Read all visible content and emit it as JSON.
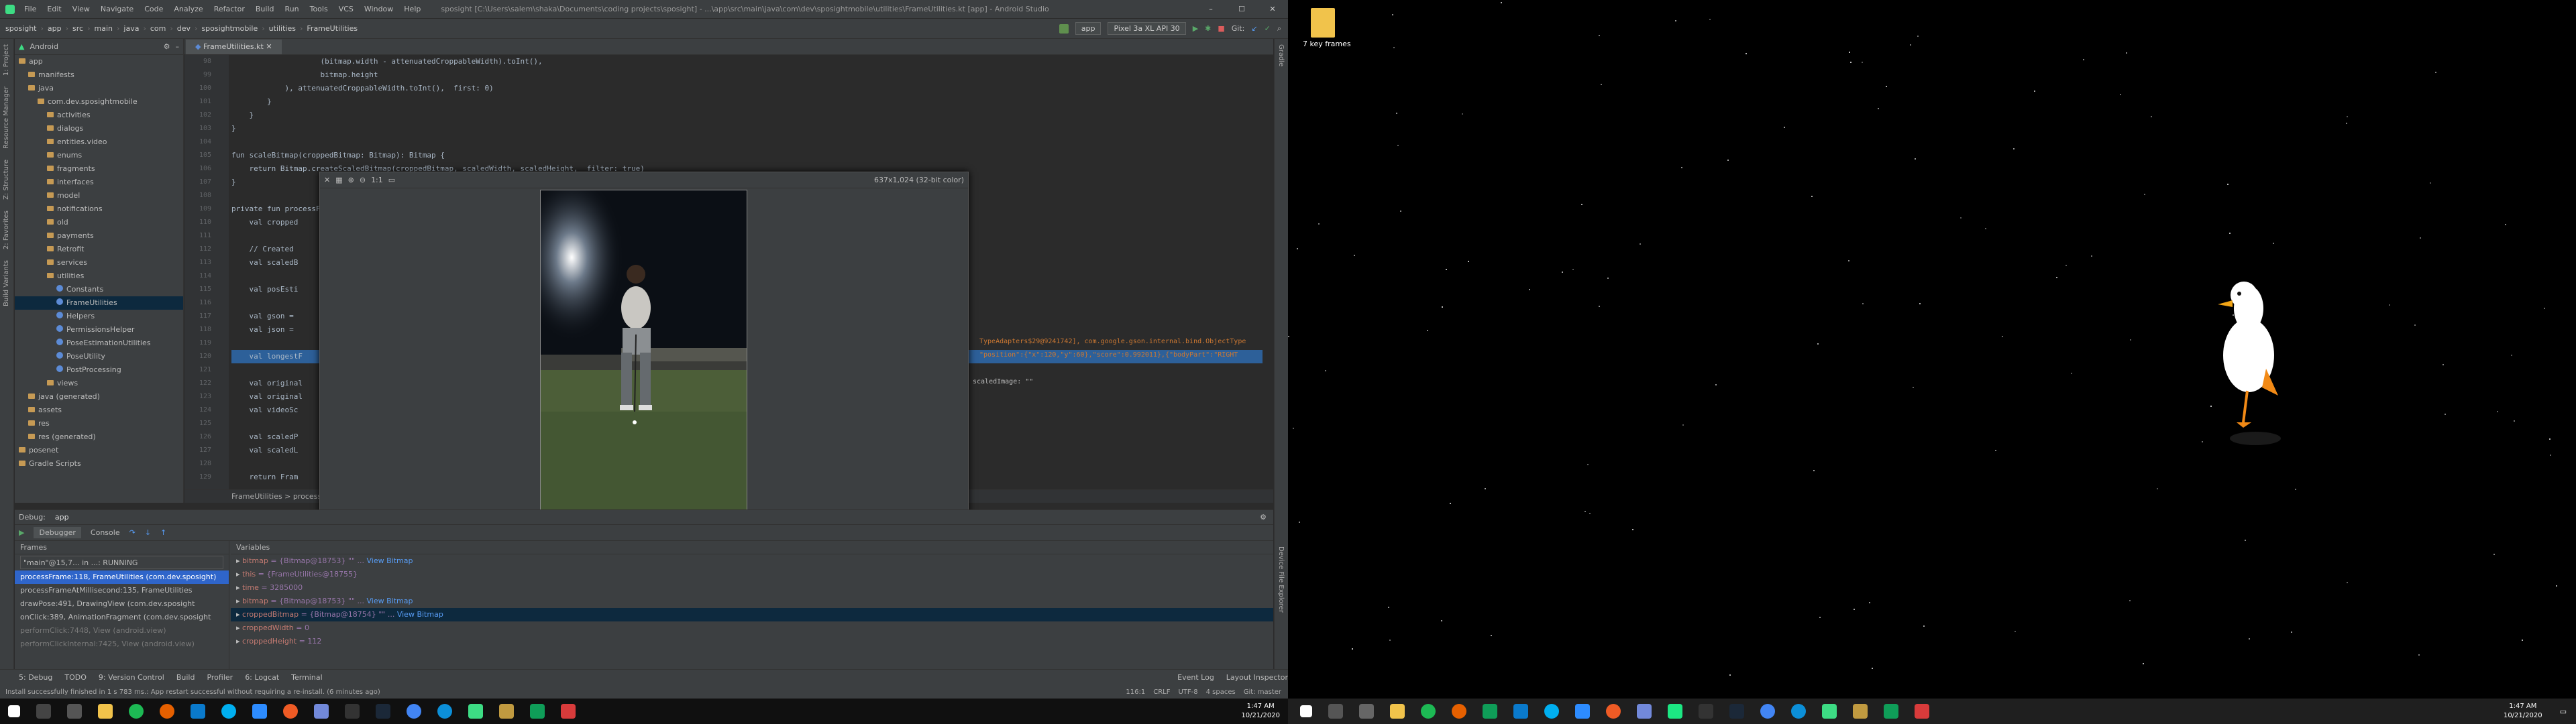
{
  "left_monitor": {
    "titlebar": {
      "menu": [
        "File",
        "Edit",
        "View",
        "Navigate",
        "Code",
        "Analyze",
        "Refactor",
        "Build",
        "Run",
        "Tools",
        "VCS",
        "Window",
        "Help"
      ],
      "title": "sposight [C:\\Users\\salem\\shaka\\Documents\\coding projects\\sposight] - ...\\app\\src\\main\\java\\com\\dev\\sposightmobile\\utilities\\FrameUtilities.kt [app] - Android Studio"
    },
    "navbar": {
      "crumbs": [
        "sposight",
        "app",
        "src",
        "main",
        "java",
        "com",
        "dev",
        "sposightmobile",
        "utilities",
        "FrameUtilities"
      ],
      "run_config": "app",
      "device": "Pixel 3a XL API 30",
      "git_label": "Git:"
    },
    "left_tabs": [
      "1: Project",
      "Resource Manager",
      "Z: Structure",
      "2: Favorites",
      "Build Variants"
    ],
    "project": {
      "header": "Android",
      "tree": [
        {
          "label": "app",
          "depth": 0,
          "type": "folder"
        },
        {
          "label": "manifests",
          "depth": 1,
          "type": "folder"
        },
        {
          "label": "java",
          "depth": 1,
          "type": "folder"
        },
        {
          "label": "com.dev.sposightmobile",
          "depth": 2,
          "type": "folder"
        },
        {
          "label": "activities",
          "depth": 3,
          "type": "folder"
        },
        {
          "label": "dialogs",
          "depth": 3,
          "type": "folder"
        },
        {
          "label": "entities.video",
          "depth": 3,
          "type": "folder"
        },
        {
          "label": "enums",
          "depth": 3,
          "type": "folder"
        },
        {
          "label": "fragments",
          "depth": 3,
          "type": "folder"
        },
        {
          "label": "interfaces",
          "depth": 3,
          "type": "folder"
        },
        {
          "label": "model",
          "depth": 3,
          "type": "folder"
        },
        {
          "label": "notifications",
          "depth": 3,
          "type": "folder"
        },
        {
          "label": "old",
          "depth": 3,
          "type": "folder"
        },
        {
          "label": "payments",
          "depth": 3,
          "type": "folder"
        },
        {
          "label": "Retrofit",
          "depth": 3,
          "type": "folder"
        },
        {
          "label": "services",
          "depth": 3,
          "type": "folder"
        },
        {
          "label": "utilities",
          "depth": 3,
          "type": "folder"
        },
        {
          "label": "Constants",
          "depth": 4,
          "type": "kt"
        },
        {
          "label": "FrameUtilities",
          "depth": 4,
          "type": "kt",
          "selected": true
        },
        {
          "label": "Helpers",
          "depth": 4,
          "type": "kt"
        },
        {
          "label": "PermissionsHelper",
          "depth": 4,
          "type": "kt"
        },
        {
          "label": "PoseEstimationUtilities",
          "depth": 4,
          "type": "kt"
        },
        {
          "label": "PoseUtility",
          "depth": 4,
          "type": "kt"
        },
        {
          "label": "PostProcessing",
          "depth": 4,
          "type": "kt"
        },
        {
          "label": "views",
          "depth": 3,
          "type": "folder"
        },
        {
          "label": "java (generated)",
          "depth": 1,
          "type": "folder"
        },
        {
          "label": "assets",
          "depth": 1,
          "type": "folder"
        },
        {
          "label": "res",
          "depth": 1,
          "type": "folder"
        },
        {
          "label": "res (generated)",
          "depth": 1,
          "type": "folder"
        },
        {
          "label": "posenet",
          "depth": 0,
          "type": "folder"
        },
        {
          "label": "Gradle Scripts",
          "depth": 0,
          "type": "folder"
        }
      ]
    },
    "editor": {
      "tab": "FrameUtilities.kt",
      "lines": [
        {
          "n": "98",
          "t": "                    (bitmap.width - attenuatedCroppableWidth).toInt(),"
        },
        {
          "n": "99",
          "t": "                    bitmap.height"
        },
        {
          "n": "100",
          "t": "            ), attenuatedCroppableWidth.toInt(),  first: 0)"
        },
        {
          "n": "101",
          "t": "        }"
        },
        {
          "n": "102",
          "t": "    }"
        },
        {
          "n": "103",
          "t": "}"
        },
        {
          "n": "104",
          "t": ""
        },
        {
          "n": "105",
          "t": "fun scaleBitmap(croppedBitmap: Bitmap): Bitmap {"
        },
        {
          "n": "106",
          "t": "    return Bitmap.createScaledBitmap(croppedBitmap, scaledWidth, scaledHeight,  filter: true)"
        },
        {
          "n": "107",
          "t": "}"
        },
        {
          "n": "108",
          "t": ""
        },
        {
          "n": "109",
          "t": "private fun processFrame("
        },
        {
          "n": "110",
          "t": "    val cropped"
        },
        {
          "n": "111",
          "t": ""
        },
        {
          "n": "112",
          "t": "    // Created"
        },
        {
          "n": "113",
          "t": "    val scaledB"
        },
        {
          "n": "114",
          "t": ""
        },
        {
          "n": "115",
          "t": "    val posEsti"
        },
        {
          "n": "116",
          "t": ""
        },
        {
          "n": "117",
          "t": "    val gson ="
        },
        {
          "n": "118",
          "t": "    val json ="
        },
        {
          "n": "119",
          "t": ""
        },
        {
          "n": "120",
          "t": "    val longestF"
        },
        {
          "n": "121",
          "t": ""
        },
        {
          "n": "122",
          "t": "    val original"
        },
        {
          "n": "123",
          "t": "    val original"
        },
        {
          "n": "124",
          "t": "    val videoSc"
        },
        {
          "n": "125",
          "t": ""
        },
        {
          "n": "126",
          "t": "    val scaledP"
        },
        {
          "n": "127",
          "t": "    val scaledL"
        },
        {
          "n": "128",
          "t": ""
        },
        {
          "n": "129",
          "t": "    return Fram"
        }
      ],
      "inline_hint_1": "TypeAdapters$29@9241742], com.google.gson.internal.bind.ObjectType",
      "inline_hint_2": "\"position\":{\"x\":120,\"y\":60},\"score\":0.992011},{\"bodyPart\":\"RIGHT",
      "inline_hint_3": "scaledImage: \"\"",
      "breadcrumb": "FrameUtilities  >  processFrame()"
    },
    "popup": {
      "info": "637x1,024 (32-bit color)"
    },
    "debug": {
      "title": "Debug:",
      "config": "app",
      "tabs": [
        "Debugger",
        "Console"
      ],
      "frames_header": "Frames",
      "thread": "\"main\"@15,7... in ...: RUNNING",
      "frames": [
        {
          "t": "processFrame:118, FrameUtilities (com.dev.sposight)",
          "sel": true
        },
        {
          "t": "processFrameAtMillisecond:135, FrameUtilities"
        },
        {
          "t": "drawPose:491, DrawingView (com.dev.sposight"
        },
        {
          "t": "onClick:389, AnimationFragment (com.dev.sposight"
        },
        {
          "t": "performClick:7448, View (android.view)"
        },
        {
          "t": "performClickInternal:7425, View (android.view)"
        }
      ],
      "variables_header": "Variables",
      "variables": [
        {
          "name": "bitmap",
          "val": "= {Bitmap@18753} \"\" ...",
          "link": "View Bitmap"
        },
        {
          "name": "this",
          "val": "= {FrameUtilities@18755}"
        },
        {
          "name": "time",
          "val": "= 3285000"
        },
        {
          "name": "bitmap",
          "val": "= {Bitmap@18753} \"\" ...",
          "link": "View Bitmap"
        },
        {
          "name": "croppedBitmap",
          "val": "= {Bitmap@18754} \"\" ...",
          "link": "View Bitmap",
          "sel": true
        },
        {
          "name": "croppedWidth",
          "val": "= 0"
        },
        {
          "name": "croppedHeight",
          "val": "= 112"
        }
      ]
    },
    "bottom_tabs": [
      "5: Debug",
      "TODO",
      "9: Version Control",
      "Build",
      "Profiler",
      "6: Logcat",
      "Terminal",
      "Event Log",
      "Layout Inspector"
    ],
    "status": {
      "message": "Install successfully finished in 1 s 783 ms.: App restart successful without requiring a re-install. (6 minutes ago)",
      "pos": "116:1",
      "crlf": "CRLF",
      "enc": "UTF-8",
      "indent": "4 spaces",
      "git": "Git: master"
    },
    "clock": {
      "time": "1:47 AM",
      "date": "10/21/2020"
    }
  },
  "right_monitor": {
    "desktop_icon_label": "7 key frames",
    "clock": {
      "time": "1:47 AM",
      "date": "10/21/2020"
    }
  }
}
